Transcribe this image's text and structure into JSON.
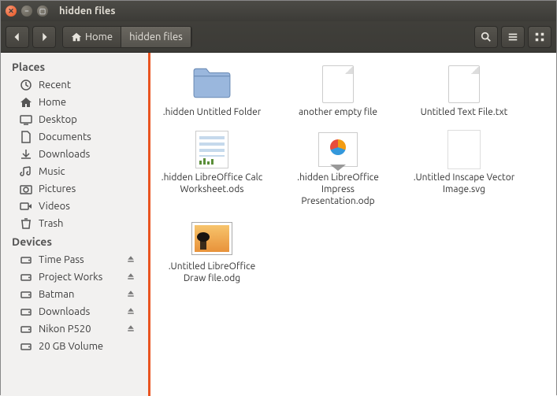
{
  "window": {
    "title": "hidden files"
  },
  "toolbar": {
    "path": [
      {
        "label": "Home",
        "home": true
      },
      {
        "label": "hidden files",
        "active": true
      }
    ]
  },
  "sidebar": {
    "headers": {
      "places": "Places",
      "devices": "Devices"
    },
    "places": [
      {
        "name": "Recent",
        "icon": "clock"
      },
      {
        "name": "Home",
        "icon": "home"
      },
      {
        "name": "Desktop",
        "icon": "desktop"
      },
      {
        "name": "Documents",
        "icon": "doc"
      },
      {
        "name": "Downloads",
        "icon": "download"
      },
      {
        "name": "Music",
        "icon": "music"
      },
      {
        "name": "Pictures",
        "icon": "camera"
      },
      {
        "name": "Videos",
        "icon": "video"
      },
      {
        "name": "Trash",
        "icon": "trash"
      }
    ],
    "devices": [
      {
        "name": "Time Pass",
        "icon": "drive",
        "eject": true
      },
      {
        "name": "Project Works",
        "icon": "drive",
        "eject": true
      },
      {
        "name": "Batman",
        "icon": "drive",
        "eject": true
      },
      {
        "name": "Downloads",
        "icon": "drive",
        "eject": true
      },
      {
        "name": "Nikon P520",
        "icon": "drive",
        "eject": true
      },
      {
        "name": "20 GB Volume",
        "icon": "drive",
        "eject": false
      }
    ]
  },
  "files": [
    {
      "name": ".hidden Untitled Folder",
      "type": "folder"
    },
    {
      "name": "another empty file",
      "type": "blank"
    },
    {
      "name": "Untitled Text File.txt",
      "type": "blank"
    },
    {
      "name": ".hidden LibreOffice Calc Worksheet.ods",
      "type": "calc"
    },
    {
      "name": ".hidden LibreOffice Impress Presentation.odp",
      "type": "impress"
    },
    {
      "name": ".Untitled Inscape Vector Image.svg",
      "type": "svg"
    },
    {
      "name": ".Untitled LibreOffice Draw file.odg",
      "type": "draw"
    }
  ]
}
